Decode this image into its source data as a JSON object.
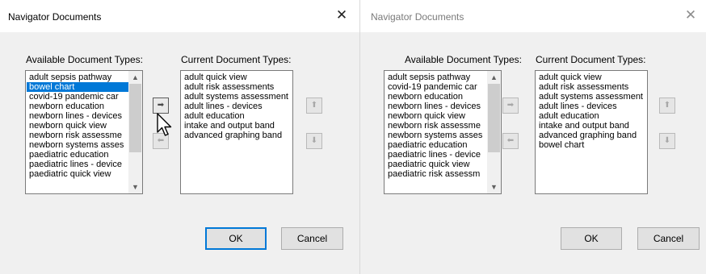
{
  "dialog1": {
    "title": "Navigator Documents",
    "available_label": "Available Document Types:",
    "current_label": "Current Document Types:",
    "available_items": [
      "adult sepsis pathway",
      "bowel chart",
      "covid-19 pandemic car",
      "newborn education",
      "newborn lines - devices",
      "newborn quick view",
      "newborn risk assessme",
      "newborn systems asses",
      "paediatric education",
      "paediatric lines - device",
      "paediatric quick view"
    ],
    "selected_item": "bowel chart",
    "current_items": [
      "adult quick view",
      "adult risk assessments",
      "adult systems assessment",
      "adult lines - devices",
      "adult education",
      "intake and output band",
      "advanced graphing band"
    ],
    "ok_label": "OK",
    "cancel_label": "Cancel"
  },
  "dialog2": {
    "title": "Navigator Documents",
    "available_label": "Available Document Types:",
    "current_label": "Current Document Types:",
    "available_items": [
      "adult sepsis pathway",
      "covid-19 pandemic car",
      "newborn education",
      "newborn lines - devices",
      "newborn quick view",
      "newborn risk assessme",
      "newborn systems asses",
      "paediatric education",
      "paediatric lines - device",
      "paediatric quick view",
      "paediatric risk assessm"
    ],
    "current_items": [
      "adult quick view",
      "adult risk assessments",
      "adult systems assessment",
      "adult lines - devices",
      "adult education",
      "intake and output band",
      "advanced graphing band",
      "bowel chart"
    ],
    "ok_label": "OK",
    "cancel_label": "Cancel"
  },
  "icons": {
    "close": "close-icon",
    "add": "arrow-right-icon",
    "remove": "arrow-left-icon",
    "move_up": "arrow-up-icon",
    "move_down": "arrow-down-icon",
    "scroll_up": "chevron-up-icon",
    "scroll_down": "chevron-down-icon",
    "cursor": "mouse-pointer-icon"
  },
  "colors": {
    "selection": "#0078d7",
    "default_button_border": "#0078d7",
    "dialog_bg": "#f0f0f0"
  }
}
